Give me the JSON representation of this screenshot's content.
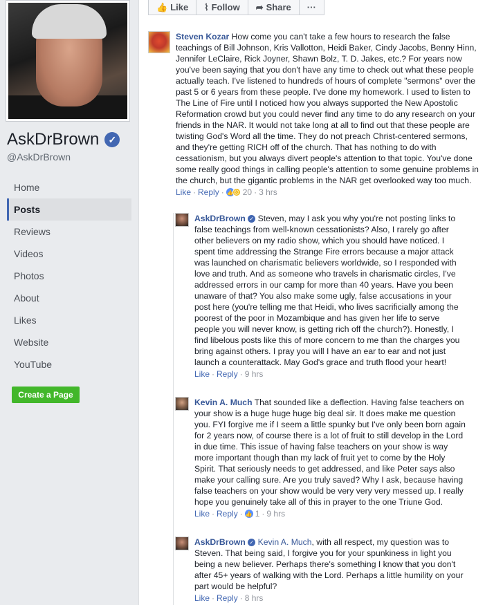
{
  "sidebar": {
    "page_name": "AskDrBrown",
    "page_handle": "@AskDrBrown",
    "nav": [
      "Home",
      "Posts",
      "Reviews",
      "Videos",
      "Photos",
      "About",
      "Likes",
      "Website",
      "YouTube"
    ],
    "active_nav": "Posts",
    "create_page": "Create a Page"
  },
  "actionbar": {
    "like": "Like",
    "follow": "Follow",
    "share": "Share",
    "more": "···"
  },
  "comments": [
    {
      "author": "Steven Kozar",
      "text": "How come you can't take a few hours to research the false teachings of Bill Johnson, Kris Vallotton, Heidi Baker, Cindy Jacobs, Benny Hinn, Jennifer LeClaire, Rick Joyner, Shawn Bolz, T. D. Jakes, etc.? For years now you've been saying that you don't have any time to check out what these people actually teach. I've listened to hundreds of hours of complete \"sermons\" over the past 5 or 6 years from these people. I've done my homework. I used to listen to The Line of Fire until I noticed how you always supported the New Apostolic Reformation crowd but you could never find any time to do any research on your friends in the NAR. It would not take long at all to find out that these people are twisting God's Word all the time. They do not preach Christ-centered sermons, and they're getting RICH off of the church. That has nothing to do with cessationism, but you always divert people's attention to that topic. You've done some really good things in calling people's attention to some genuine problems in the church, but the gigantic problems in the NAR get overlooked way too much.",
      "like": "Like",
      "reply": "Reply",
      "reactions": "20",
      "time": "3 hrs"
    },
    {
      "author": "AskDrBrown",
      "text": "Steven, may I ask you why you're not posting links to false teachings from well-known cessationists? Also, I rarely go after other believers on my radio show, which you should have noticed. I spent time addressing the Strange Fire errors because a major attack was launched on charismatic believers worldwide, so I responded with love and truth. And as someone who travels in charismatic circles, I've addressed errors in our camp for more than 40 years. Have you been unaware of that? You also make some ugly, false accusations in your post here (you're telling me that Heidi, who lives sacrificially among the poorest of the poor in Mozambique and has given her life to serve people you will never know, is getting rich off the church?). Honestly, I find libelous posts like this of more concern to me than the charges you bring against others. I pray you will I have an ear to ear and not just launch a counterattack. May God's grace and truth flood your heart!",
      "like": "Like",
      "reply": "Reply",
      "time": "9 hrs"
    },
    {
      "author": "Kevin A. Much",
      "text": "That sounded like a deflection. Having false teachers on your show is a huge huge huge big deal sir. It does make me question you. FYI forgive me if I seem a little spunky but I've only been born again for 2 years now, of course there is a lot of fruit to still develop in the Lord in due time. This issue of having false teachers on your show is way more important though than my lack of fruit yet to come by the Holy Spirit. That seriously needs to get addressed, and like Peter says also make your calling sure. Are you truly saved? Why I ask, because having false teachers on your show would be very very very messed up. I really hope you genuinely take all of this in prayer to the one Triune God.",
      "like": "Like",
      "reply": "Reply",
      "reactions": "1",
      "time": "9 hrs"
    },
    {
      "author": "AskDrBrown",
      "mention": "Kevin A. Much",
      "text": ", with all respect, my question was to Steven. That being said, I forgive you for your spunkiness in light you being a new believer. Perhaps there's something I know that you don't after 45+ years of walking with the Lord. Perhaps a little humility on your part would be helpful?",
      "like": "Like",
      "reply": "Reply",
      "time": "8 hrs"
    }
  ]
}
